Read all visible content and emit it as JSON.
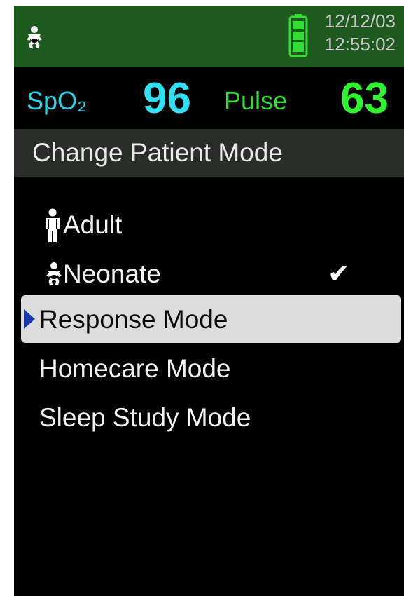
{
  "header": {
    "mode_icon": "neonate-icon",
    "battery_icon": "battery-full-icon",
    "date": "12/12/03",
    "time": "12:55:02"
  },
  "vitals": {
    "spo2_label": "SpO₂",
    "spo2_value": "96",
    "pulse_label": "Pulse",
    "pulse_value": "63"
  },
  "title": "Change Patient Mode",
  "menu": {
    "items": [
      {
        "label": "Adult",
        "icon": "adult-icon",
        "checked": false,
        "selected": false
      },
      {
        "label": "Neonate",
        "icon": "neonate-icon",
        "checked": true,
        "selected": false
      },
      {
        "label": "Response Mode",
        "selected": true
      },
      {
        "label": "Homecare Mode"
      },
      {
        "label": "Sleep Study Mode"
      }
    ],
    "check_glyph": "✔"
  },
  "colors": {
    "header_bg": "#1e5a1e",
    "spo2": "#2ee0f2",
    "pulse": "#2ff52f",
    "title_bg": "#2a2d2a",
    "selection_bg": "#dcdcdc",
    "pointer": "#1a3aa8",
    "battery": "#33dd33"
  }
}
